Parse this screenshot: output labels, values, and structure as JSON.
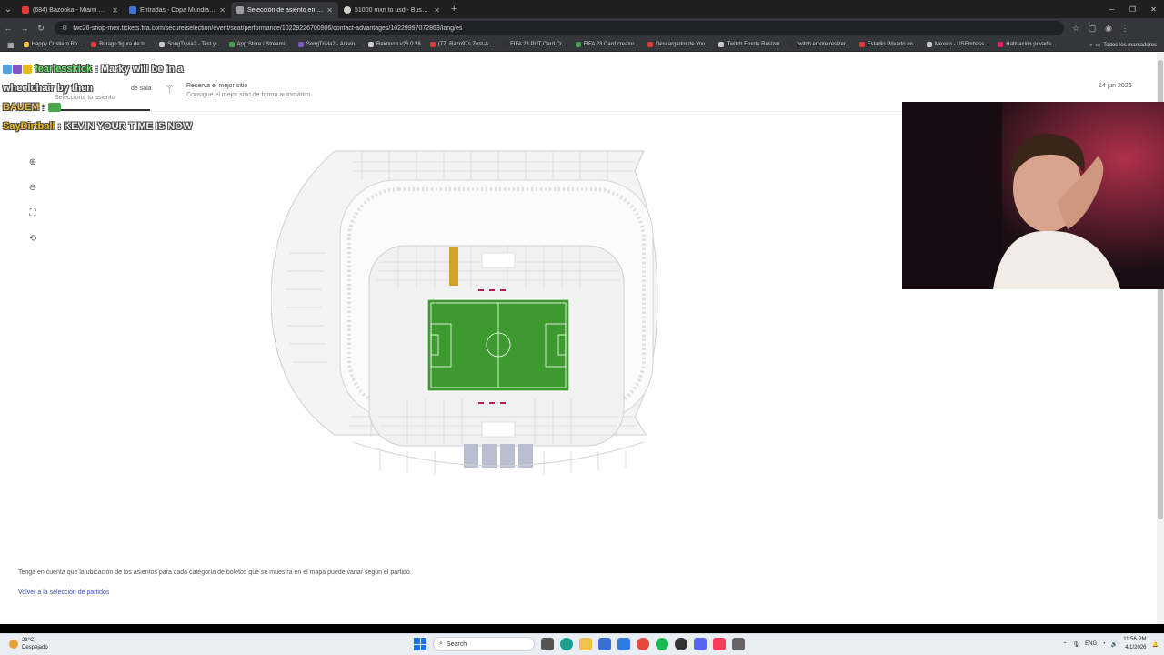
{
  "browser": {
    "tabs": [
      {
        "title": "(684) Bazooka - Miami XD [Off",
        "favicon_color": "#e53935",
        "active": false
      },
      {
        "title": "Entradas - Copa Mundial de la",
        "favicon_color": "#3f6fd8",
        "active": false
      },
      {
        "title": "Selección de asiento en el map",
        "favicon_color": "#9e9e9e",
        "active": true
      },
      {
        "title": "51000 mxn to usd - Buscar co",
        "favicon_color": "#cfcfcf",
        "active": false
      }
    ],
    "new_tab_label": "+",
    "url": "fwc26-shop-mex.tickets.fifa.com/secure/selection/event/seat/performance/10229226700906/contact-advantages/10229997072863/lang/es"
  },
  "bookmarks": {
    "items": [
      {
        "label": "Happy Cristiero Ro...",
        "color": "#f4c542"
      },
      {
        "label": "Burago figura de to...",
        "color": "#e53935"
      },
      {
        "label": "SongTrivia2 - Test y...",
        "color": "#cccccc"
      },
      {
        "label": "App Store / Streami...",
        "color": "#43a047"
      },
      {
        "label": "SongTrivia2 - Adivin...",
        "color": "#7e57c2"
      },
      {
        "label": "Reletoob v26.0.28",
        "color": "#cccccc"
      },
      {
        "label": "(77) Razo97s Zest-A...",
        "color": "#e53935"
      },
      {
        "label": "FIFA 23 PUT Card Cr...",
        "color": "#333333"
      },
      {
        "label": "FIFA 23 Card creator...",
        "color": "#43a047"
      },
      {
        "label": "Descargador de You...",
        "color": "#e53935"
      },
      {
        "label": "Twitch Emote Resizer",
        "color": "#cccccc"
      },
      {
        "label": "twitch emote resizer...",
        "color": "#333333"
      },
      {
        "label": "Estadio Privado en...",
        "color": "#e53935"
      },
      {
        "label": "Mexico - USEmbass...",
        "color": "#cccccc"
      },
      {
        "label": "Habitación privada...",
        "color": "#e91e63"
      }
    ],
    "all_label": "Todos los marcadores"
  },
  "page": {
    "step1_title": "de sala",
    "step1_sub": "Selecciona tu asiento",
    "step2_title": "Reserva el mejor sitio",
    "step2_sub": "Consigue el mejor sitio de forma automático",
    "date": "14 jun 2026",
    "note": "Tenga en cuenta que la ubicación de los asientos para cada categoría de boletos que se muestra en el mapa puede variar según el partido.",
    "back_link": "Volver a la selección de partidos",
    "colors": {
      "pitch": "#3d9a2e",
      "highlight": "#d4a02a",
      "accent_link": "#3f51b5"
    }
  },
  "chat": [
    {
      "user": "fearlesskick",
      "message": "Marky will be in a wheelchair by then"
    },
    {
      "user": "BAUEM",
      "message": ""
    },
    {
      "user": "SayDirtball",
      "message": "KEVIN YOUR TIME IS NOW"
    }
  ],
  "taskbar": {
    "weather_temp": "23°C",
    "weather_desc": "Despejado",
    "search_label": "Search",
    "lang": "ENG",
    "time": "11:56 PM",
    "date": "4/1/2026"
  }
}
